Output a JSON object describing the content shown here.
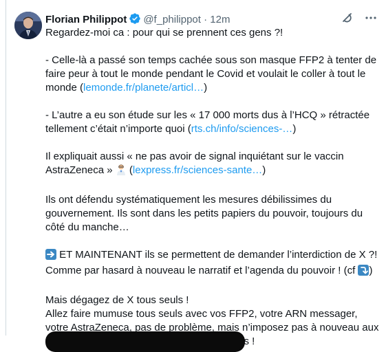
{
  "author": {
    "name": "Florian Philippot",
    "handle": "@f_philippot",
    "separator": "·",
    "time": "12m"
  },
  "colors": {
    "link": "#1d9bf0",
    "verified": "#1d9bf0",
    "secondary_text": "#536471"
  },
  "icons": {
    "verified": "verified-badge-icon",
    "grok": "grok-icon",
    "more": "more-options-icon",
    "arrow_right_emoji": "arrow-right-emoji",
    "arrow_curved_emoji": "arrow-curved-down-emoji",
    "scientist_emoji": "scientist-emoji"
  },
  "tweet": {
    "line1": "Regardez-moi ca : pour qui se prennent ces gens ?!",
    "p2_text": "- Celle-là a passé son temps cachée sous son masque FFP2 à tenter de faire peur à tout le monde pendant le Covid et voulait le coller à tout le monde (",
    "p2_link": "lemonde.fr/planete/articl…",
    "p2_end": ")",
    "p3_text": "- L’autre a eu son étude sur les « 17 000 morts dus à l’HCQ » rétractée tellement c’était n’importe quoi (",
    "p3_link": "rts.ch/info/sciences-…",
    "p3_end": ")",
    "p4_text": "Il expliquait aussi « ne pas avoir de signal inquiétant sur le vaccin AstraZeneca » ",
    "p4_open": " (",
    "p4_link": "lexpress.fr/sciences-sante…",
    "p4_end": ")",
    "p5": "Ils ont défendu systématiquement les mesures débilissimes du gouvernement. Ils sont dans les petits papiers du pouvoir, toujours du côté du manche…",
    "p6_text": " ET MAINTENANT ils se permettent de demander l’interdiction de X ?! Comme par hasard à nouveau le narratif et l’agenda du pouvoir ! (cf ",
    "p6_end": ")",
    "p7_line1": "Mais dégagez de X tous seuls !",
    "p7_line2": "Allez faire mumuse tous seuls avec vos FFP2, votre ARN messager, votre AstraZeneca, pas de problème, mais n’imposez pas à nouveau aux gens vos délires paranoïaques et liberticides !"
  }
}
